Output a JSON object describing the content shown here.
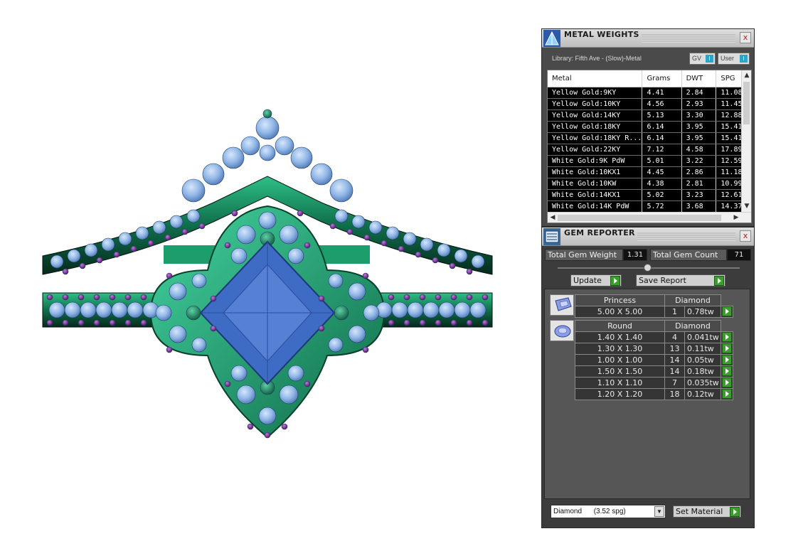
{
  "metal_panel": {
    "title": "METAL WEIGHTS",
    "close": "x",
    "library": "Library: Fifth Ave - (Slow)-Metal",
    "gv_label": "GV",
    "user_label": "User",
    "toggle_glyph": "I",
    "columns": [
      "Metal",
      "Grams",
      "DWT",
      "SPG"
    ],
    "rows": [
      [
        "Yellow Gold:9KY",
        "4.41",
        "2.84",
        "11.08"
      ],
      [
        "Yellow Gold:10KY",
        "4.56",
        "2.93",
        "11.45"
      ],
      [
        "Yellow Gold:14KY",
        "5.13",
        "3.30",
        "12.88"
      ],
      [
        "Yellow Gold:18KY",
        "6.14",
        "3.95",
        "15.41"
      ],
      [
        "Yellow Gold:18KY R...",
        "6.14",
        "3.95",
        "15.41"
      ],
      [
        "Yellow Gold:22KY",
        "7.12",
        "4.58",
        "17.89"
      ],
      [
        "White Gold:9K PdW",
        "5.01",
        "3.22",
        "12.59"
      ],
      [
        "White Gold:10KX1",
        "4.45",
        "2.86",
        "11.18"
      ],
      [
        "White Gold:10KW",
        "4.38",
        "2.81",
        "10.99"
      ],
      [
        "White Gold:14KX1",
        "5.02",
        "3.23",
        "12.61"
      ],
      [
        "White Gold:14K PdW",
        "5.72",
        "3.68",
        "14.37"
      ]
    ]
  },
  "gem_panel": {
    "title": "GEM REPORTER",
    "close": "x",
    "total_weight_label": "Total Gem Weight",
    "total_weight_value": "1.31",
    "total_count_label": "Total Gem Count",
    "total_count_value": "71",
    "update_label": "Update",
    "save_label": "Save Report",
    "groups": [
      {
        "shape": "Princess",
        "material": "Diamond",
        "rows": [
          {
            "size": "5.00 X 5.00",
            "count": "1",
            "tw": "0.78tw"
          }
        ]
      },
      {
        "shape": "Round",
        "material": "Diamond",
        "rows": [
          {
            "size": "1.40 X 1.40",
            "count": "4",
            "tw": "0.041tw"
          },
          {
            "size": "1.30 X 1.30",
            "count": "13",
            "tw": "0.11tw"
          },
          {
            "size": "1.00 X 1.00",
            "count": "14",
            "tw": "0.05tw"
          },
          {
            "size": "1.50 X 1.50",
            "count": "14",
            "tw": "0.18tw"
          },
          {
            "size": "1.10 X 1.10",
            "count": "7",
            "tw": "0.035tw"
          },
          {
            "size": "1.20 X 1.20",
            "count": "18",
            "tw": "0.12tw"
          }
        ]
      }
    ],
    "material_select": "Diamond      (3.52 spg)",
    "set_material_label": "Set Material"
  },
  "colors": {
    "metal_green": "#1a8a5e",
    "metal_dark": "#0c3d2a",
    "gem_blue": "#8fb6e6",
    "center_stone": "#3e6bc4",
    "accent_purple": "#7a2a9a",
    "go_green": "#3a9d2c"
  },
  "icons": {
    "metal_title": "pyramid-icon",
    "gem_title": "gem-report-icon",
    "princess": "princess-cut-icon",
    "round": "round-cut-icon"
  }
}
